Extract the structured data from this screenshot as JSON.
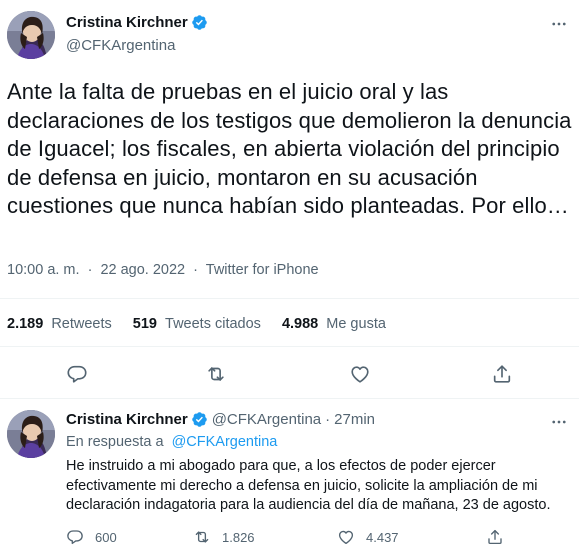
{
  "main_tweet": {
    "author_name": "Cristina Kirchner",
    "author_handle": "@CFKArgentina",
    "text": "Ante la falta de pruebas en el juicio oral y las declaraciones de los testigos que demolieron la denuncia de Iguacel; los fiscales, en abierta violación del principio de defensa en juicio, montaron en su acusación cuestiones que nunca habían sido planteadas. Por ello…",
    "time": "10:00 a. m.",
    "separator": "·",
    "date": "22 ago. 2022",
    "source": "Twitter for iPhone",
    "stats": [
      {
        "value": "2.189",
        "label": "Retweets"
      },
      {
        "value": "519",
        "label": "Tweets citados"
      },
      {
        "value": "4.988",
        "label": "Me gusta"
      }
    ]
  },
  "reply_tweet": {
    "author_name": "Cristina Kirchner",
    "author_handle": "@CFKArgentina",
    "dot": "·",
    "time_ago": "27min",
    "reply_prefix": "En respuesta a",
    "reply_handle": "@CFKArgentina",
    "text": "He instruido a mi abogado para que, a los efectos de poder ejercer efectivamente mi derecho a defensa en juicio, solicite la ampliación de mi declaración indagatoria para la audiencia del día de mañana, 23 de agosto.",
    "reply_count": "600",
    "retweet_count": "1.826",
    "like_count": "4.437"
  },
  "icons": {
    "verified": "verified-badge-icon",
    "more": "more-dots-icon",
    "reply": "reply-bubble-icon",
    "retweet": "retweet-icon",
    "like": "heart-icon",
    "share": "share-icon"
  },
  "colors": {
    "accent": "#1d9bf0",
    "text": "#0f1419",
    "muted": "#536471",
    "divider": "#eff3f4"
  }
}
